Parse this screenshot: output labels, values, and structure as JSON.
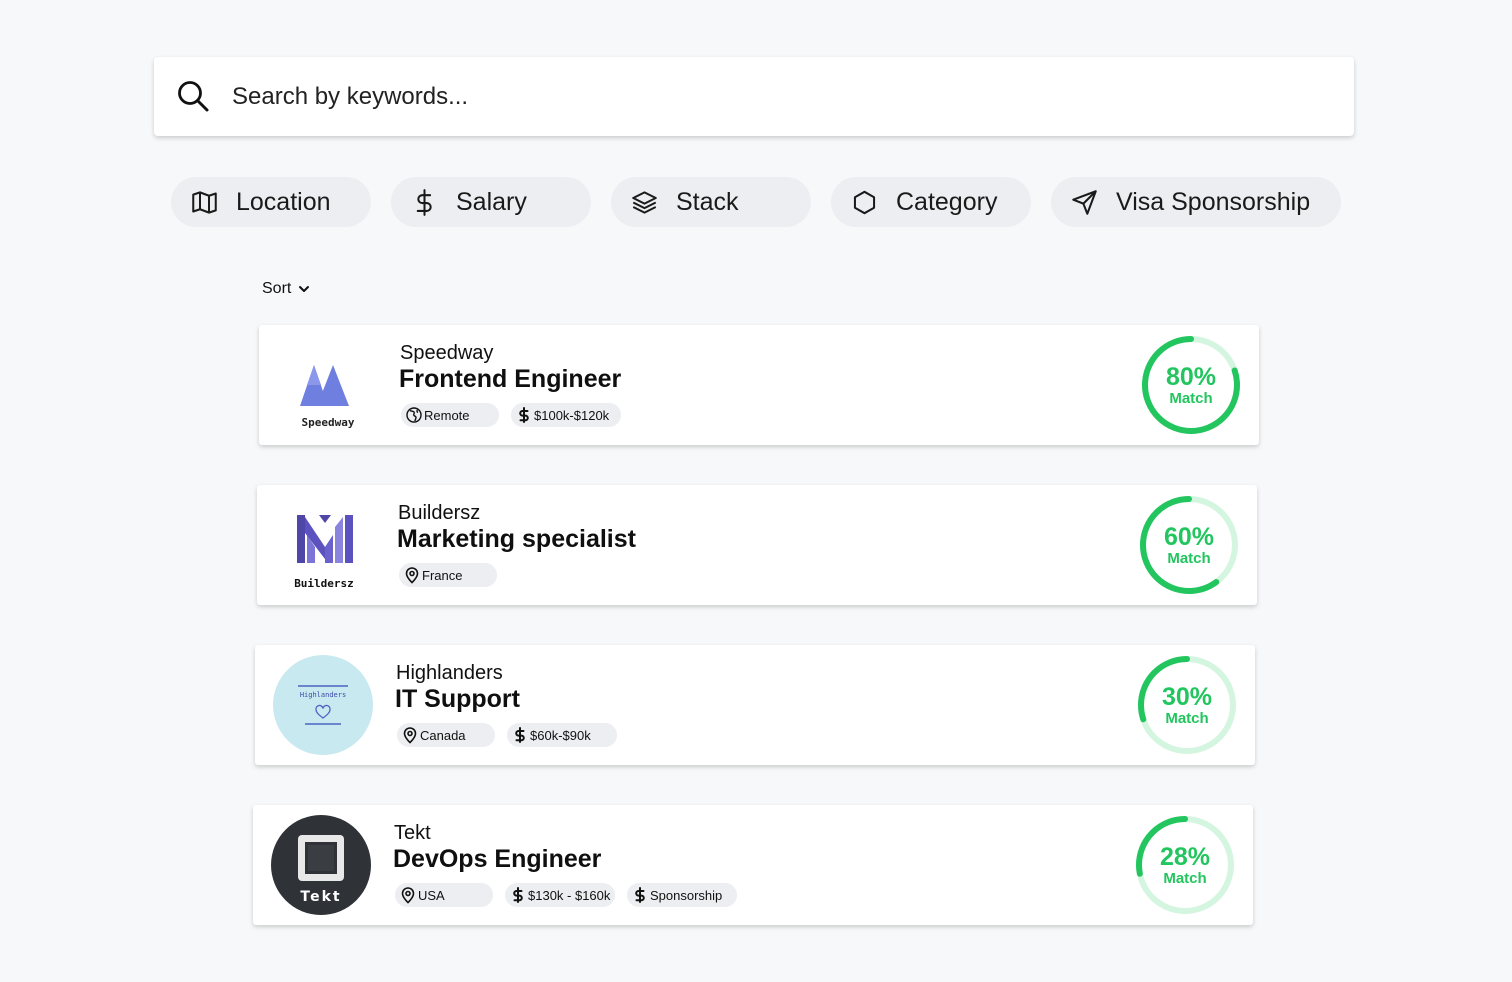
{
  "search": {
    "placeholder": "Search by keywords..."
  },
  "filters": [
    {
      "label": "Location",
      "icon": "map-icon"
    },
    {
      "label": "Salary",
      "icon": "dollar-icon"
    },
    {
      "label": "Stack",
      "icon": "layers-icon"
    },
    {
      "label": "Category",
      "icon": "hexagon-icon"
    },
    {
      "label": "Visa Sponsorship",
      "icon": "send-icon"
    }
  ],
  "sort": {
    "label": "Sort"
  },
  "colors": {
    "match": "#22c55e",
    "match_track": "#d4f5df",
    "chip": "#eceef1"
  },
  "jobs": [
    {
      "company": "Speedway",
      "title": "Frontend Engineer",
      "logo_text": "Speedway",
      "tags": [
        {
          "icon": "globe-icon",
          "label": "Remote"
        },
        {
          "icon": "dollar-icon",
          "label": "$100k-$120k"
        }
      ],
      "match_percent": 80,
      "match_text": "80%",
      "match_label": "Match"
    },
    {
      "company": "Buildersz",
      "title": "Marketing specialist",
      "logo_text": "Buildersz",
      "tags": [
        {
          "icon": "location-pin-icon",
          "label": "France"
        }
      ],
      "match_percent": 60,
      "match_text": "60%",
      "match_label": "Match"
    },
    {
      "company": "Highlanders",
      "title": "IT Support",
      "logo_text": "Highlanders",
      "tags": [
        {
          "icon": "location-pin-icon",
          "label": "Canada"
        },
        {
          "icon": "dollar-icon",
          "label": "$60k-$90k"
        }
      ],
      "match_percent": 30,
      "match_text": "30%",
      "match_label": "Match"
    },
    {
      "company": "Tekt",
      "title": "DevOps Engineer",
      "logo_text": "Tekt",
      "tags": [
        {
          "icon": "location-pin-icon",
          "label": "USA"
        },
        {
          "icon": "dollar-icon",
          "label": "$130k - $160k"
        },
        {
          "icon": "dollar-icon",
          "label": "Sponsorship"
        }
      ],
      "match_percent": 28,
      "match_text": "28%",
      "match_label": "Match"
    }
  ]
}
